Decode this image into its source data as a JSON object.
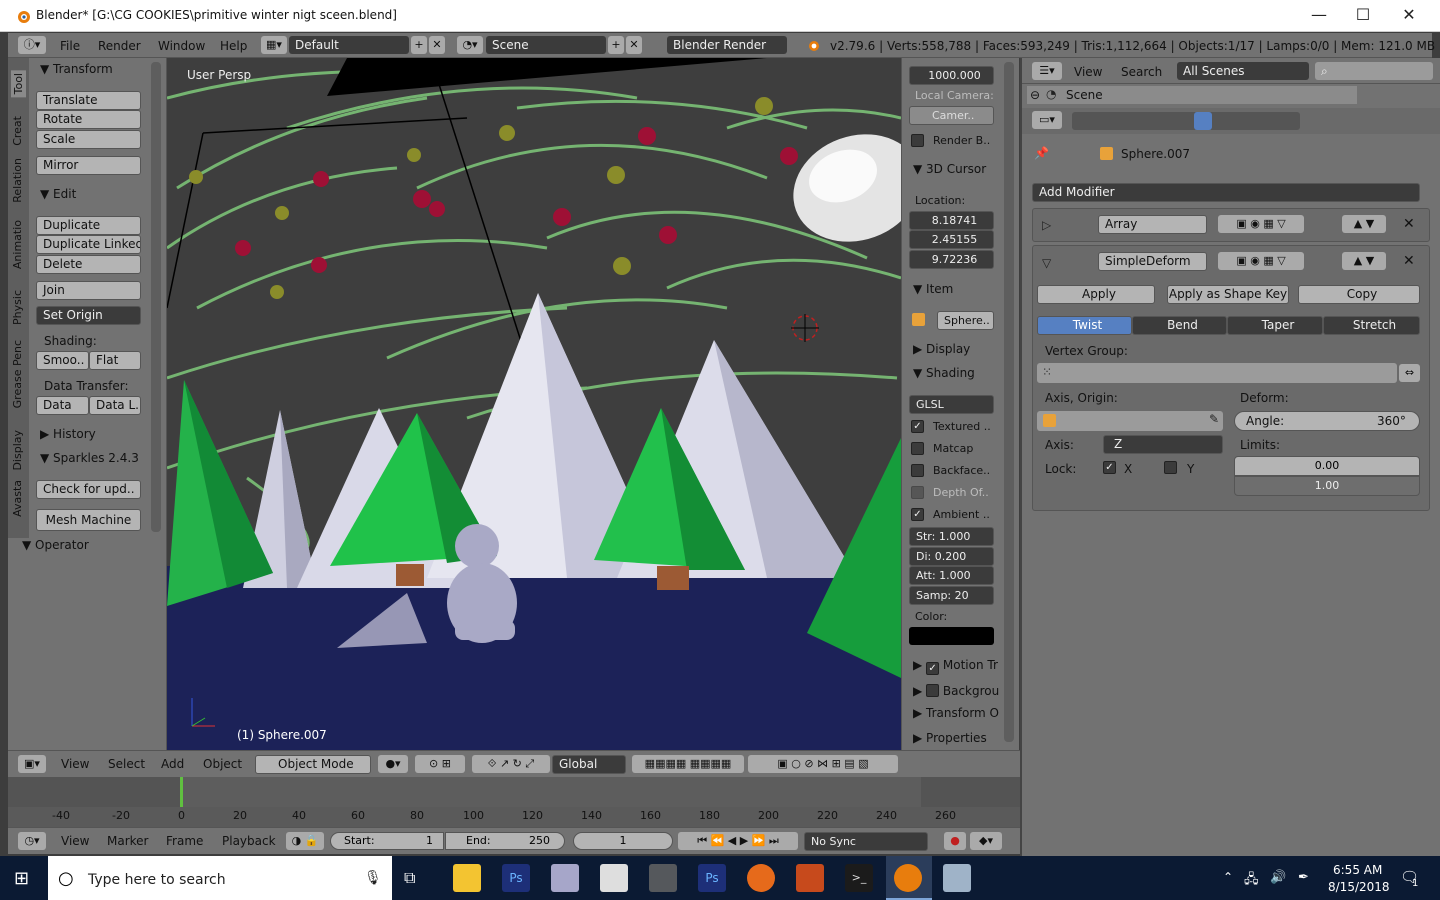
{
  "window": {
    "title": "Blender* [G:\\CG COOKIES\\primitive winter nigt sceen.blend]",
    "min": "—",
    "max": "☐",
    "close": "✕"
  },
  "info": {
    "menus": [
      "File",
      "Render",
      "Window",
      "Help"
    ],
    "layout": "Default",
    "scene": "Scene",
    "engine": "Blender Render",
    "stats": "v2.79.6 | Verts:558,788 | Faces:593,249 | Tris:1,112,664 | Objects:1/17 | Lamps:0/0 | Mem: 121.0 MB |"
  },
  "toolshelf": {
    "tabs": [
      "Tool",
      "Creat",
      "Relation",
      "Animatio",
      "Physic",
      "Grease Penc",
      "Display",
      "Avasta"
    ],
    "transform_header": "Transform",
    "translate": "Translate",
    "rotate": "Rotate",
    "scale": "Scale",
    "mirror": "Mirror",
    "edit_header": "Edit",
    "duplicate": "Duplicate",
    "duplicate_linked": "Duplicate Linked",
    "delete": "Delete",
    "join": "Join",
    "set_origin": "Set Origin",
    "shading_label": "Shading:",
    "smooth": "Smoo..",
    "flat": "Flat",
    "data_transfer_label": "Data Transfer:",
    "data": "Data",
    "data_l": "Data L..",
    "history": "History",
    "sparkles": "Sparkles 2.4.3",
    "check_update": "Check for upd..",
    "mesh_machine": "Mesh Machine",
    "operator": "Operator"
  },
  "viewport": {
    "view_name": "User Persp",
    "object_label": "(1) Sphere.007"
  },
  "npanel": {
    "clip_end": "1000.000",
    "local_camera": "Local Camera:",
    "camera": "Camer..",
    "render_border": "Render B..",
    "cursor_header": "3D Cursor",
    "location": "Location:",
    "x": "8.18741",
    "y": "2.45155",
    "z": "9.72236",
    "item_header": "Item",
    "item_name": "Sphere..",
    "display_header": "Display",
    "shading_header": "Shading",
    "glsl": "GLSL",
    "textured": "Textured ..",
    "matcap": "Matcap",
    "backface": "Backface..",
    "depth": "Depth Of..",
    "ambient": "Ambient ..",
    "str": "Str: 1.000",
    "di": "Di:  0.200",
    "att": "Att: 1.000",
    "samp": "Samp: 20",
    "color": "Color:",
    "motion": "Motion Tr",
    "backgrou": "Backgrou",
    "transform_o": "Transform O",
    "properties": "Properties"
  },
  "props": {
    "view": "View",
    "search": "Search",
    "all_scenes": "All Scenes",
    "scene": "Scene",
    "object_name": "Sphere.007",
    "add_modifier": "Add Modifier",
    "mod1_name": "Array",
    "mod2_name": "SimpleDeform",
    "apply": "Apply",
    "apply_shape": "Apply as Shape Key",
    "copy": "Copy",
    "twist": "Twist",
    "bend": "Bend",
    "taper": "Taper",
    "stretch": "Stretch",
    "vertex_group": "Vertex Group:",
    "axis_origin": "Axis, Origin:",
    "deform": "Deform:",
    "angle": "Angle:",
    "angle_value": "360°",
    "axis_label": "Axis:",
    "axis_value": "Z",
    "limits": "Limits:",
    "lock": "Lock:",
    "lock_x": "X",
    "lock_y": "Y",
    "limit_min": "0.00",
    "limit_max": "1.00"
  },
  "vheader": {
    "menus": [
      "View",
      "Select",
      "Add",
      "Object"
    ],
    "mode": "Object Mode",
    "orientation": "Global"
  },
  "timeline": {
    "ticks": [
      "-40",
      "-20",
      "0",
      "20",
      "40",
      "60",
      "80",
      "100",
      "120",
      "140",
      "160",
      "180",
      "200",
      "220",
      "240",
      "260"
    ],
    "menus": [
      "View",
      "Marker",
      "Frame",
      "Playback"
    ],
    "start": "Start:",
    "start_val": "1",
    "end": "End:",
    "end_val": "250",
    "current": "1",
    "sync": "No Sync"
  },
  "taskbar": {
    "search": "Type here to search",
    "time": "6:55 AM",
    "date": "8/15/2018",
    "notif": "1"
  }
}
